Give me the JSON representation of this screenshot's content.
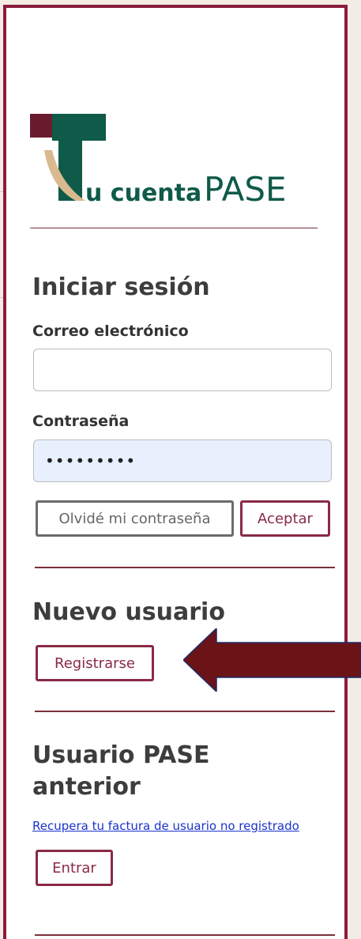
{
  "brand": {
    "mark_letter": "T",
    "name_part1": "u cuenta",
    "name_part2": "PASE"
  },
  "login": {
    "title": "Iniciar sesión",
    "email_label": "Correo electrónico",
    "email_value": "",
    "password_label": "Contraseña",
    "password_value": "•••••••••",
    "forgot_label": "Olvidé mi contraseña",
    "submit_label": "Aceptar"
  },
  "new_user": {
    "title": "Nuevo usuario",
    "register_label": "Registrarse"
  },
  "previous_user": {
    "title_line1": "Usuario PASE",
    "title_line2": "anterior",
    "invoice_link": "Recupera tu factura de usuario no registrado",
    "enter_label": "Entrar"
  },
  "colors": {
    "accent": "#8a2a45",
    "logo_green": "#0f5a48",
    "logo_maroon": "#6a1b2d",
    "logo_tan": "#d9b98f",
    "arrow": "#6b1418",
    "input_autofill": "#e8f0fe"
  }
}
